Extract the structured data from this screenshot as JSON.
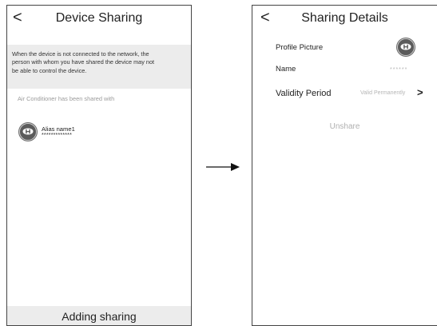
{
  "left": {
    "back_glyph": "<",
    "title": "Device Sharing",
    "notice_lines": [
      "When the device is not connected to the network, the",
      "person with whom you have shared the device may not",
      "be able to control the device."
    ],
    "shared_with": "Air Conditioner has been shared with",
    "user": {
      "alias": "Alias name1",
      "masked": "*************"
    },
    "add_button": "Adding sharing"
  },
  "right": {
    "back_glyph": "<",
    "title": "Sharing Details",
    "profile_picture_label": "Profile Picture",
    "name_label": "Name",
    "name_value": "******",
    "validity_label": "Validity Period",
    "validity_value": "Valid Permanently",
    "chevron_glyph": ">",
    "unshare": "Unshare"
  },
  "icons": {
    "back": "chevron-left-icon",
    "avatar": "user-avatar-icon",
    "flow_arrow": "arrow-right-icon",
    "chevron": "chevron-right-icon"
  },
  "colors": {
    "notice_bg": "#ececec",
    "muted_text": "#9b9b9b",
    "avatar_bg": "#5b5b5b"
  }
}
